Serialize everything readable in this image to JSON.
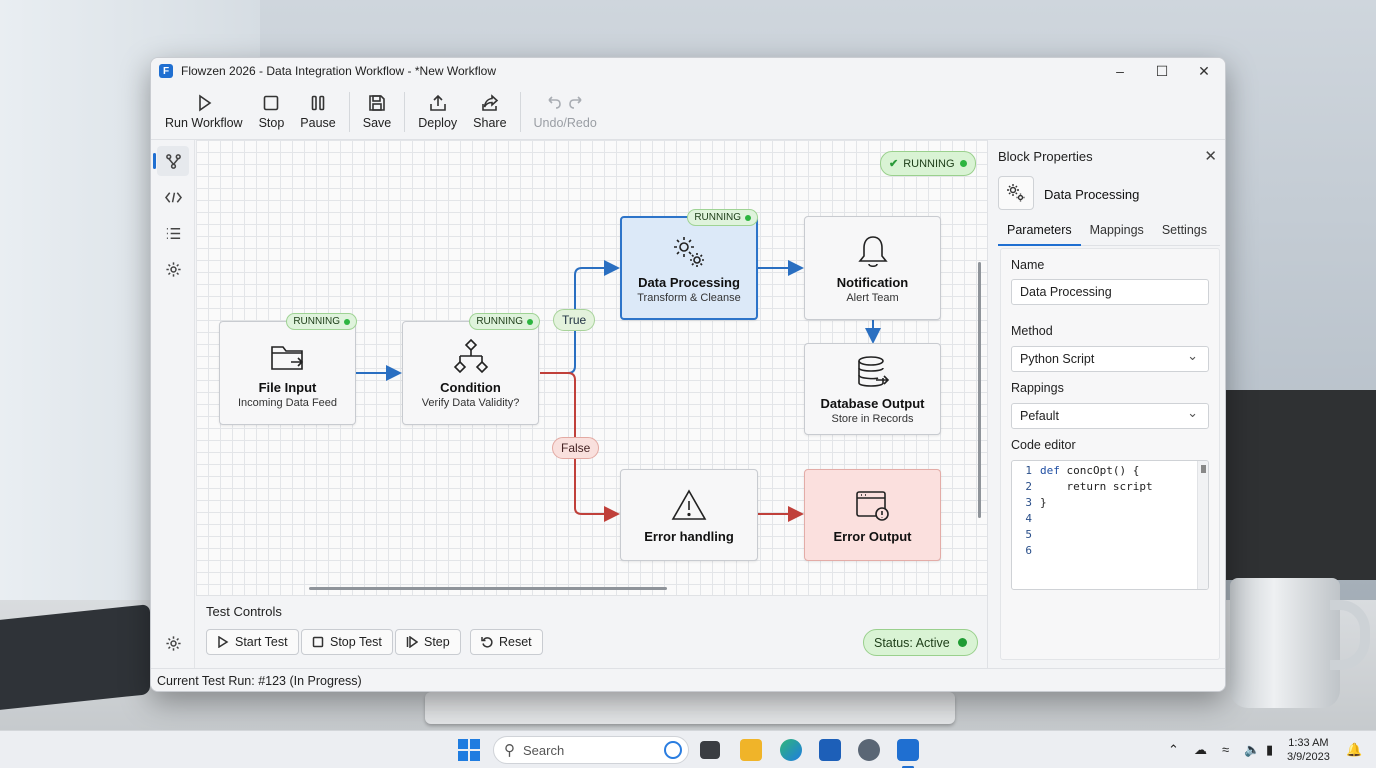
{
  "window": {
    "title": "Flowzen 2026 - Data Integration Workflow - *New Workflow",
    "app_icon_letter": "F"
  },
  "toolbar": {
    "run": "Run Workflow",
    "stop": "Stop",
    "pause": "Pause",
    "save": "Save",
    "deploy": "Deploy",
    "share": "Share",
    "undo_redo": "Undo/Redo"
  },
  "canvas": {
    "global_status": "RUNNING",
    "running_badge": "RUNNING",
    "nodes": {
      "file_input": {
        "title": "File Input",
        "subtitle": "Incoming Data Feed",
        "status": "RUNNING"
      },
      "condition": {
        "title": "Condition",
        "subtitle": "Verify Data Validity?",
        "status": "RUNNING"
      },
      "data_processing": {
        "title": "Data Processing",
        "subtitle": "Transform & Cleanse",
        "status": "RUNNING"
      },
      "notification": {
        "title": "Notification",
        "subtitle": "Alert Team"
      },
      "database_output": {
        "title": "Database Output",
        "subtitle": "Store in Records"
      },
      "error_handling": {
        "title": "Error handling"
      },
      "error_output": {
        "title": "Error Output"
      }
    },
    "edge_labels": {
      "true": "True",
      "false": "False"
    },
    "colors": {
      "flow": "#2a6fc1",
      "error": "#c0403a",
      "success": "#2db540"
    }
  },
  "test_controls": {
    "title": "Test Controls",
    "start": "Start Test",
    "stop": "Stop Test",
    "step": "Step",
    "reset": "Reset",
    "status": "Status: Active"
  },
  "statusbar": {
    "text": "Current Test Run: #123 (In Progress)"
  },
  "properties": {
    "title": "Block Properties",
    "block_name": "Data Processing",
    "tabs": [
      "Parameters",
      "Mappings",
      "Settings"
    ],
    "name_label": "Name",
    "name_value": "Data Processing",
    "method_label": "Method",
    "method_value": "Python Script",
    "rappings_label": "Rappings",
    "rappings_value": "Pefault",
    "code_label": "Code editor",
    "code_lines": [
      {
        "n": "1",
        "kw": "def",
        "text": " concOpt() {"
      },
      {
        "n": "2",
        "kw": "",
        "text": "    return script"
      },
      {
        "n": "3",
        "kw": "",
        "text": "}"
      },
      {
        "n": "4",
        "kw": "",
        "text": ""
      },
      {
        "n": "5",
        "kw": "",
        "text": ""
      },
      {
        "n": "6",
        "kw": "",
        "text": ""
      }
    ]
  },
  "taskbar": {
    "search_placeholder": "Search",
    "time": "1:33 AM",
    "date": "3/9/2023"
  }
}
